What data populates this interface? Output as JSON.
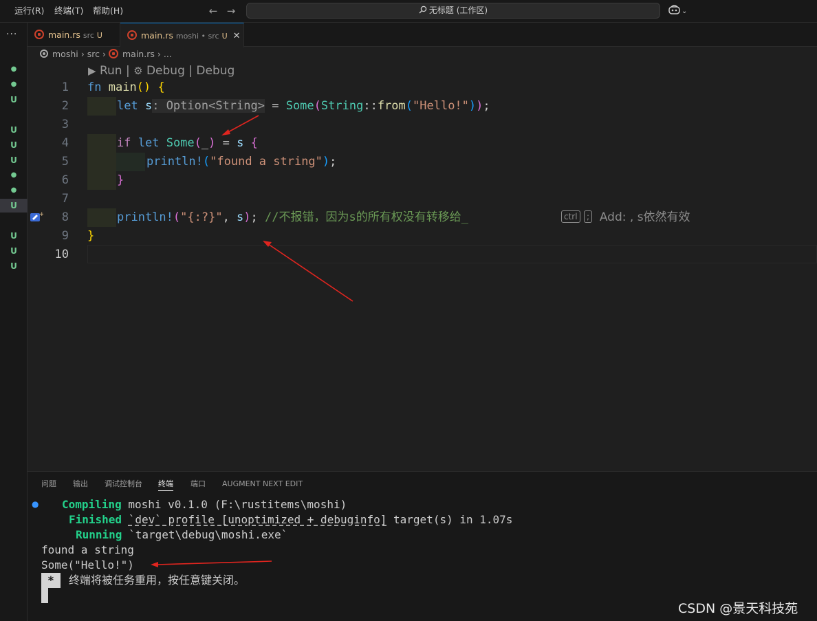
{
  "titlebar": {
    "menus": [
      "运行(R)",
      "终端(T)",
      "帮助(H)"
    ],
    "search_text": "无标题 (工作区)"
  },
  "activity": {
    "more": "···"
  },
  "scm_badges": [
    "●",
    "●",
    "U",
    "U",
    "U",
    "U",
    "●",
    "●",
    "U",
    "U",
    "U",
    "U"
  ],
  "tabs": [
    {
      "name": "main.rs",
      "desc": "src",
      "status": "U",
      "active": false
    },
    {
      "name": "main.rs",
      "desc": "moshi • src",
      "status": "U",
      "active": true,
      "close": "✕"
    }
  ],
  "breadcrumb": [
    "moshi",
    "src",
    "main.rs",
    "..."
  ],
  "codelens": {
    "run": "Run",
    "debug1": "Debug",
    "debug2": "Debug",
    "sep": " | "
  },
  "line_numbers": [
    "1",
    "2",
    "3",
    "4",
    "5",
    "6",
    "7",
    "8",
    "9",
    "10"
  ],
  "code": {
    "l1": {
      "kw": "fn",
      "name": "main",
      "parens": "()",
      "brace": "{"
    },
    "l2": {
      "kw": "let",
      "var": "s",
      "inlay": ": Option<String>",
      "eq": " = ",
      "some": "Some",
      "open": "(",
      "ty": "String",
      "sep": "::",
      "from": "from",
      "open2": "(",
      "str": "\"Hello!\"",
      "close2": ")",
      "close": ")",
      "semi": ";"
    },
    "l4": {
      "kw1": "if",
      "kw2": "let",
      "some": "Some",
      "open": "(",
      "us": "_",
      "close": ")",
      "eq": " = ",
      "var": "s",
      "brace": "{"
    },
    "l5": {
      "mac": "println!",
      "open": "(",
      "str": "\"found a string\"",
      "close": ")",
      "semi": ";"
    },
    "l6": {
      "brace": "}"
    },
    "l8": {
      "mac": "println!",
      "open": "(",
      "str": "\"{:?}\"",
      "comma": ", ",
      "var": "s",
      "close": ")",
      "semi": "; ",
      "comment": "//不报错，因为s的所有权没有转移给_",
      "key1": "ctrl",
      "key2": ";",
      "hint": "Add: , s依然有效"
    },
    "l9": {
      "brace": "}"
    }
  },
  "panel": {
    "tabs": [
      "问题",
      "输出",
      "调试控制台",
      "终端",
      "端口",
      "AUGMENT NEXT EDIT"
    ],
    "active_tab": "终端",
    "terminal": {
      "compiling_label": "Compiling",
      "compiling_text": " moshi v0.1.0 (F:\\rustitems\\moshi)",
      "finished_label": "Finished",
      "finished_profile": "`dev` profile [unoptimized + debuginfo]",
      "finished_rest": " target(s) in 1.07s",
      "running_label": "Running",
      "running_text": " `target\\debug\\moshi.exe`",
      "out1": "found a string",
      "out2": "Some(\"Hello!\")",
      "star": "*",
      "reuse_msg": "终端将被任务重用，按任意键关闭。"
    }
  },
  "watermark": "CSDN @景天科技苑",
  "colors": {
    "accent": "#0078d4",
    "annotation_arrow": "#e0251f",
    "terminal_green": "#23d18b"
  }
}
